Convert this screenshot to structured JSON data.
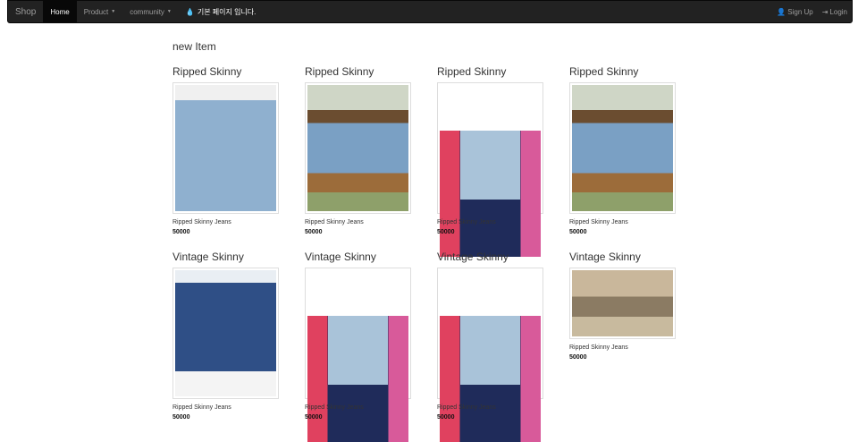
{
  "navbar": {
    "brand": "Shop",
    "items": [
      {
        "label": "Home",
        "active": true
      },
      {
        "label": "Product",
        "dropdown": true
      },
      {
        "label": "community",
        "dropdown": true
      }
    ],
    "notice": "기본 페이지 입니다.",
    "right": [
      {
        "label": "Sign Up",
        "icon": "user-icon"
      },
      {
        "label": "Login",
        "icon": "login-icon"
      }
    ]
  },
  "section": {
    "title": "new Item"
  },
  "products": [
    {
      "title": "Ripped Skinny",
      "name": "Ripped Skinny Jeans",
      "price": "50000",
      "image": "denim-light"
    },
    {
      "title": "Ripped Skinny",
      "name": "Ripped Skinny Jeans",
      "price": "50000",
      "image": "fence"
    },
    {
      "title": "Ripped Skinny",
      "name": "Ripped Skinny Jeans",
      "price": "50000",
      "image": "torn-pink"
    },
    {
      "title": "Ripped Skinny",
      "name": "Ripped Skinny Jeans",
      "price": "50000",
      "image": "fence"
    },
    {
      "title": "Vintage Skinny",
      "name": "Ripped Skinny Jeans",
      "price": "50000",
      "image": "dark-denim"
    },
    {
      "title": "Vintage Skinny",
      "name": "Ripped Skinny Jeans",
      "price": "50000",
      "image": "torn-pink"
    },
    {
      "title": "Vintage Skinny",
      "name": "Ripped Skinny Jeans",
      "price": "50000",
      "image": "torn-pink"
    },
    {
      "title": "Vintage Skinny",
      "name": "Ripped Skinny Jeans",
      "price": "50000",
      "image": "rocks"
    }
  ]
}
